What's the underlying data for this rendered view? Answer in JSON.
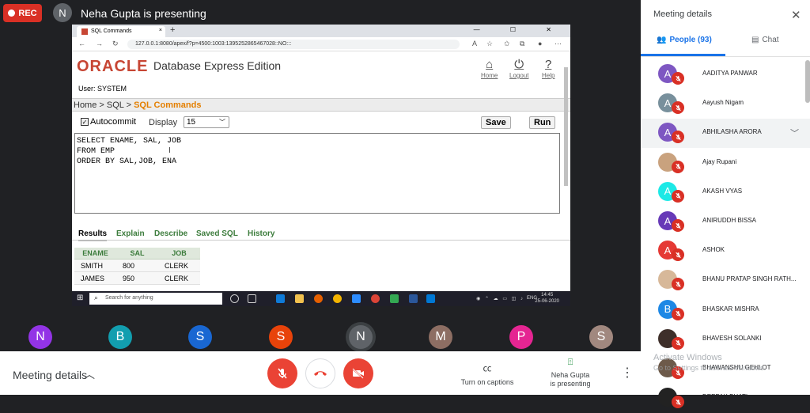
{
  "meeting": {
    "rec_label": "REC",
    "presenter_initial": "N",
    "presenting_text": "Neha Gupta is presenting"
  },
  "browser": {
    "tab_title": "SQL Commands",
    "tab_close": "×",
    "new_tab": "+",
    "window_controls": "— ☐ ✕",
    "url": "127.0.0.1:8080/apex/f?p=4500:1003:1395252865467028::NO:::"
  },
  "apex": {
    "logo": "ORACLE",
    "edition": "Database Express Edition",
    "user": "User: SYSTEM",
    "header_links": [
      {
        "label": "Home",
        "icon": "home-icon",
        "glyph": "⌂"
      },
      {
        "label": "Logout",
        "icon": "logout-icon",
        "glyph": "⏻"
      },
      {
        "label": "Help",
        "icon": "help-icon",
        "glyph": "?"
      }
    ],
    "breadcrumb": {
      "home": "Home",
      "sep": ">",
      "sql": "SQL",
      "current": "SQL Commands"
    },
    "autocommit_label": "Autocommit",
    "autocommit_checked": true,
    "display_label": "Display",
    "display_value": "15",
    "save_label": "Save",
    "run_label": "Run",
    "sql_text": "SELECT ENAME, SAL, JOB\nFROM EMP\nORDER BY SAL,JOB, ENA",
    "result_tabs": [
      "Results",
      "Explain",
      "Describe",
      "Saved SQL",
      "History"
    ],
    "table": {
      "headers": [
        "ENAME",
        "SAL",
        "JOB"
      ],
      "rows": [
        [
          "SMITH",
          "800",
          "CLERK"
        ],
        [
          "JAMES",
          "950",
          "CLERK"
        ]
      ]
    }
  },
  "taskbar": {
    "search_placeholder": "Search for anything",
    "lang": "ENG",
    "time": "14:45",
    "date": "25-06-2020"
  },
  "participants_strip": [
    {
      "initial": "N",
      "color": "#9334e6"
    },
    {
      "initial": "B",
      "color": "#129eaf"
    },
    {
      "initial": "S",
      "color": "#1967d2"
    },
    {
      "initial": "S",
      "color": "#e8430a"
    },
    {
      "initial": "N",
      "color": "#5f6368"
    },
    {
      "initial": "M",
      "color": "#8d6e63"
    },
    {
      "initial": "P",
      "color": "#e52592"
    },
    {
      "initial": "S",
      "color": "#a1887f"
    }
  ],
  "bottom": {
    "meeting_details": "Meeting details",
    "captions": "Turn on captions",
    "presenting_line1": "Neha Gupta",
    "presenting_line2": "is presenting"
  },
  "panel": {
    "title": "Meeting details",
    "people_tab": "People (93)",
    "chat_tab": "Chat",
    "people": [
      {
        "name": "AADITYA PANWAR",
        "initial": "A",
        "color": "#7e57c2"
      },
      {
        "name": "Aayush Nigam",
        "initial": "A",
        "color": "#78909c"
      },
      {
        "name": "ABHILASHA ARORA",
        "initial": "A",
        "color": "#7e57c2"
      },
      {
        "name": "Ajay Rupani",
        "initial": "",
        "color": "#c9a27e"
      },
      {
        "name": "AKASH VYAS",
        "initial": "A",
        "color": "#1de9e6"
      },
      {
        "name": "ANIRUDDH BISSA",
        "initial": "A",
        "color": "#673ab7"
      },
      {
        "name": "ASHOK",
        "initial": "A",
        "color": "#e53935"
      },
      {
        "name": "BHANU PRATAP SINGH RATH...",
        "initial": "",
        "color": "#d7b899"
      },
      {
        "name": "BHASKAR MISHRA",
        "initial": "B",
        "color": "#1e88e5"
      },
      {
        "name": "BHAVESH SOLANKI",
        "initial": "",
        "color": "#3e2f2a"
      },
      {
        "name": "BHAWANSHU GEHLOT",
        "initial": "",
        "color": "#6d5a4a"
      },
      {
        "name": "DEEPAK BHATI",
        "initial": "",
        "color": "#222"
      }
    ]
  },
  "watermark": {
    "line1": "Activate Windows",
    "line2": "Go to Settings to activate Windows."
  }
}
